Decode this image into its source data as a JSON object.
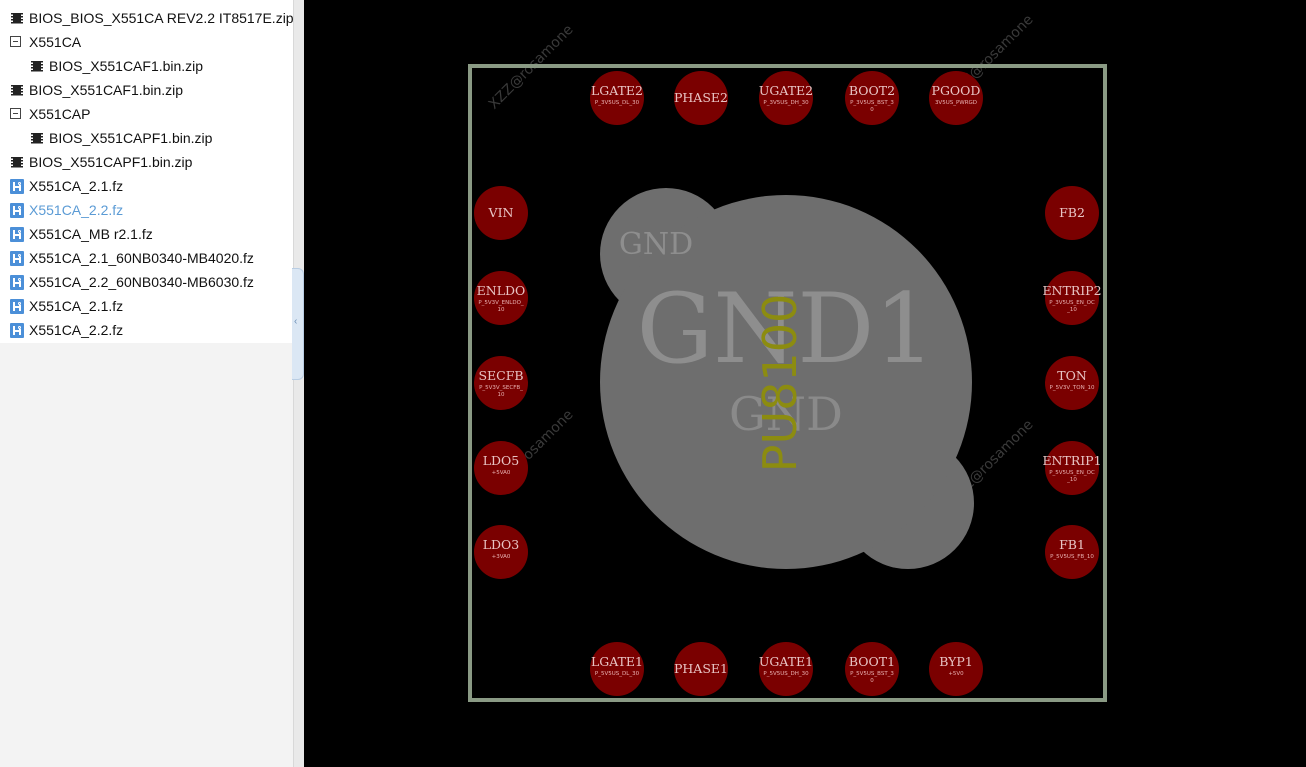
{
  "file_tree": {
    "items": [
      {
        "label": "BIOS_BIOS_X551CA REV2.2 IT8517E.zip",
        "icon": "chip-icon",
        "level": 0
      },
      {
        "label": "X551CA",
        "icon": "collapse-icon",
        "level": 0
      },
      {
        "label": "BIOS_X551CAF1.bin.zip",
        "icon": "chip-icon",
        "level": 1
      },
      {
        "label": "BIOS_X551CAF1.bin.zip",
        "icon": "chip-icon",
        "level": 0
      },
      {
        "label": "X551CAP",
        "icon": "collapse-icon",
        "level": 0
      },
      {
        "label": "BIOS_X551CAPF1.bin.zip",
        "icon": "chip-icon",
        "level": 1
      },
      {
        "label": "BIOS_X551CAPF1.bin.zip",
        "icon": "chip-icon",
        "level": 0
      },
      {
        "label": "X551CA_2.1.fz",
        "icon": "boardview-file-icon",
        "level": 0
      },
      {
        "label": "X551CA_2.2.fz",
        "icon": "boardview-file-icon",
        "level": 0,
        "selected": true
      },
      {
        "label": "X551CA_MB r2.1.fz",
        "icon": "boardview-file-icon",
        "level": 0
      },
      {
        "label": "X551CA_2.1_60NB0340-MB4020.fz",
        "icon": "boardview-file-icon",
        "level": 0
      },
      {
        "label": "X551CA_2.2_60NB0340-MB6030.fz",
        "icon": "boardview-file-icon",
        "level": 0
      },
      {
        "label": "X551CA_2.1.fz",
        "icon": "boardview-file-icon",
        "level": 0
      },
      {
        "label": "X551CA_2.2.fz",
        "icon": "boardview-file-icon",
        "level": 0
      }
    ]
  },
  "splitter": {
    "arrow": "‹"
  },
  "pcb": {
    "component_ref": "PU8100",
    "gnd_pad_label": "GND1",
    "gnd_net_label": "GND",
    "gnd_small_label": "GND",
    "watermark": "XZZ@rosamone",
    "colors": {
      "outline": "#8a9a84",
      "pad": "#7a0000",
      "gnd": "#6e6e6e",
      "ref": "#8c8c10"
    },
    "top_pads": [
      {
        "name": "LGATE2",
        "net": "P_3V5US_DL_30"
      },
      {
        "name": "PHASE2",
        "net": ""
      },
      {
        "name": "UGATE2",
        "net": "P_3V5US_DH_30"
      },
      {
        "name": "BOOT2",
        "net": "P_3V5US_BST_3",
        "net2": "0"
      },
      {
        "name": "PGOOD",
        "net": "3V5US_PWRGD"
      }
    ],
    "bottom_pads": [
      {
        "name": "LGATE1",
        "net": "P_5V5US_DL_30"
      },
      {
        "name": "PHASE1",
        "net": ""
      },
      {
        "name": "UGATE1",
        "net": "P_5V5US_DH_30"
      },
      {
        "name": "BOOT1",
        "net": "P_5V5US_BST_3",
        "net2": "0"
      },
      {
        "name": "BYP1",
        "net": "+5V0"
      }
    ],
    "left_pads": [
      {
        "name": "VIN",
        "net": ""
      },
      {
        "name": "ENLDO",
        "net": "P_5V3V_ENLDO_",
        "net2": "10"
      },
      {
        "name": "SECFB",
        "net": "P_5V3V_SECFB_",
        "net2": "10"
      },
      {
        "name": "LDO5",
        "net": "+5VA0"
      },
      {
        "name": "LDO3",
        "net": "+3VA0"
      }
    ],
    "right_pads": [
      {
        "name": "FB2",
        "net": ""
      },
      {
        "name": "ENTRIP2",
        "net": "P_3V5US_EN_OC",
        "net2": "_10"
      },
      {
        "name": "TON",
        "net": "P_5V3V_TON_10"
      },
      {
        "name": "ENTRIP1",
        "net": "P_5V5US_EN_OC",
        "net2": "_10"
      },
      {
        "name": "FB1",
        "net": "P_5V5US_FB_10"
      }
    ]
  }
}
